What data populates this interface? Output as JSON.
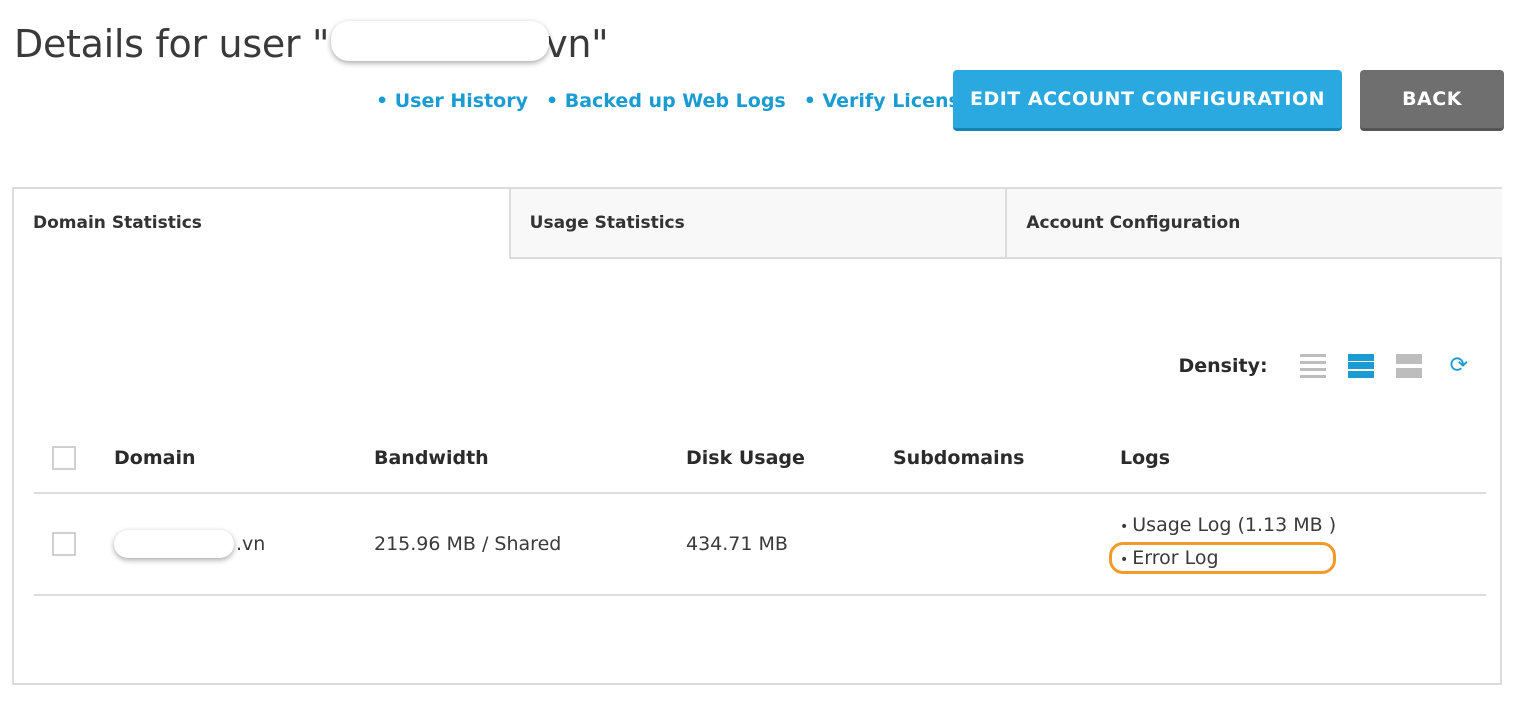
{
  "header": {
    "title_prefix": "Details for user \"",
    "title_suffix": "vn\""
  },
  "links": [
    {
      "label": "• User History"
    },
    {
      "label": "• Backed up Web Logs"
    },
    {
      "label": "• Verify License"
    }
  ],
  "buttons": {
    "edit_label": "EDIT ACCOUNT CONFIGURATION",
    "back_label": "BACK"
  },
  "tabs": [
    {
      "label": "Domain Statistics",
      "active": true
    },
    {
      "label": "Usage Statistics",
      "active": false
    },
    {
      "label": "Account Configuration",
      "active": false
    }
  ],
  "density": {
    "label": "Density:",
    "selected": "medium"
  },
  "table": {
    "columns": [
      "Domain",
      "Bandwidth",
      "Disk Usage",
      "Subdomains",
      "Logs"
    ],
    "rows": [
      {
        "domain_suffix": ".vn",
        "bandwidth": "215.96 MB / Shared",
        "disk_usage": "434.71 MB",
        "subdomains": "",
        "logs": [
          "Usage Log (1.13 MB )",
          "Error Log"
        ]
      }
    ]
  },
  "colors": {
    "accent": "#1a9cd3",
    "edit_button": "#2aa8e0",
    "back_button": "#6f6f6f",
    "highlight": "#f39a2b"
  }
}
